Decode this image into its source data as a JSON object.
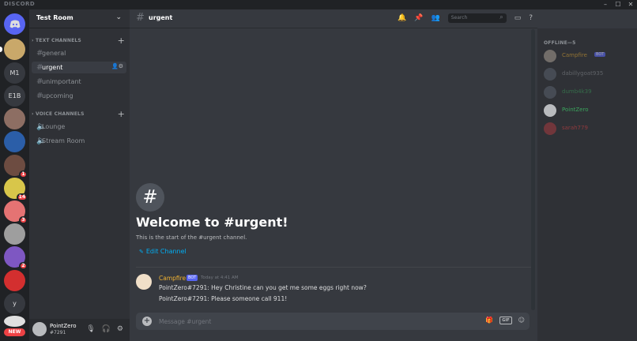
{
  "titlebar": {
    "brand": "DISCORD",
    "controls": [
      "–",
      "☐",
      "✕"
    ]
  },
  "guilds": [
    {
      "name": "home",
      "label": "",
      "color": "#5865f2",
      "icon": "discord-logo-icon"
    },
    {
      "name": "guild-1",
      "label": "",
      "color": "#c9a86a"
    },
    {
      "name": "guild-m1",
      "label": "M1",
      "color": "#36393f"
    },
    {
      "name": "guild-e1b",
      "label": "E1B",
      "color": "#36393f"
    },
    {
      "name": "guild-4",
      "label": "",
      "color": "#8d6e63"
    },
    {
      "name": "guild-5",
      "label": "",
      "color": "#2b5ea8"
    },
    {
      "name": "guild-6",
      "label": "",
      "color": "#6d4c41",
      "badge": "1"
    },
    {
      "name": "guild-7",
      "label": "",
      "color": "#d8c64a",
      "badge": "14"
    },
    {
      "name": "guild-8",
      "label": "",
      "color": "#e57373",
      "badge": "3"
    },
    {
      "name": "guild-9",
      "label": "",
      "color": "#9e9e9e"
    },
    {
      "name": "guild-10",
      "label": "",
      "color": "#7e57c2",
      "badge": "2"
    },
    {
      "name": "guild-11",
      "label": "",
      "color": "#d32f2f"
    },
    {
      "name": "guild-y",
      "label": "y",
      "color": "#36393f"
    },
    {
      "name": "guild-14",
      "label": "",
      "color": "#e0e0e0"
    }
  ],
  "new_badge": "NEW",
  "server": {
    "name": "Test Room"
  },
  "categories": {
    "text": "TEXT CHANNELS",
    "voice": "VOICE CHANNELS"
  },
  "text_channels": [
    "general",
    "urgent",
    "unimportant",
    "upcoming"
  ],
  "voice_channels": [
    "Lounge",
    "Stream Room"
  ],
  "user": {
    "name": "PointZero",
    "tag": "#7291"
  },
  "channel": {
    "name": "urgent"
  },
  "search": {
    "placeholder": "Search"
  },
  "welcome": {
    "title": "Welcome to #urgent!",
    "subtitle": "This is the start of the #urgent channel.",
    "edit": "Edit Channel"
  },
  "message": {
    "author": "Campfire",
    "bot_tag": "BOT",
    "time": "Today at 4:41 AM",
    "lines": [
      "PointZero#7291: Hey Christine can you get me some eggs right now?",
      "PointZero#7291: Please someone call 911!"
    ]
  },
  "composer": {
    "placeholder": "Message #urgent",
    "gif": "GIF"
  },
  "members": {
    "heading": "OFFLINE—5",
    "list": [
      {
        "name": "Campfire",
        "bot": "BOT",
        "color": "#f0b232",
        "avatar": "#f0dfc8"
      },
      {
        "name": "dabillygoat935",
        "bot": "",
        "color": "#8e9297",
        "avatar": "#747f8d"
      },
      {
        "name": "dumb4k39",
        "bot": "",
        "color": "#3ba55d",
        "avatar": "#747f8d"
      },
      {
        "name": "PointZero",
        "bot": "",
        "color": "#3ba55d",
        "avatar": "#b9bbbe"
      },
      {
        "name": "sarah779",
        "bot": "",
        "color": "#ed4245",
        "avatar": "#ed4245"
      }
    ]
  }
}
